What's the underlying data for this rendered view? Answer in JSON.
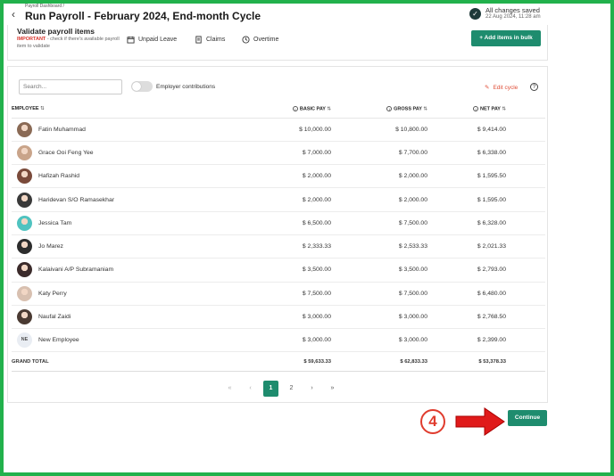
{
  "header": {
    "breadcrumb": "Payroll Dashboard /",
    "title": "Run Payroll - February 2024, End-month Cycle",
    "save_status": "All changes saved",
    "save_time": "22 Aug 2024, 11:28 am"
  },
  "validate": {
    "title": "Validate payroll items",
    "note_important": "IMPORTANT",
    "note_text": " - check if there's available payroll item to validate",
    "tabs": [
      {
        "label": "Unpaid Leave",
        "icon": "calendar-icon"
      },
      {
        "label": "Claims",
        "icon": "receipt-icon"
      },
      {
        "label": "Overtime",
        "icon": "clock-icon"
      }
    ],
    "bulk_button": "+ Add items in bulk"
  },
  "toolbar": {
    "search_placeholder": "Search...",
    "toggle_label": "Employer contributions",
    "toggle_on": false,
    "edit_cycle": "Edit cycle"
  },
  "table": {
    "columns": {
      "employee": "EMPLOYEE",
      "basic": "BASIC PAY",
      "gross": "GROSS PAY",
      "net": "NET PAY"
    },
    "rows": [
      {
        "name": "Fatin Muhammad",
        "basic": "$ 10,000.00",
        "gross": "$ 10,800.00",
        "net": "$ 9,414.00",
        "avatar_color": "#8a6a55"
      },
      {
        "name": "Grace Ooi Feng Yee",
        "basic": "$ 7,000.00",
        "gross": "$ 7,700.00",
        "net": "$ 6,338.00",
        "avatar_color": "#c9a48a"
      },
      {
        "name": "Hafizah Rashid",
        "basic": "$ 2,000.00",
        "gross": "$ 2,000.00",
        "net": "$ 1,595.50",
        "avatar_color": "#7a4a3a"
      },
      {
        "name": "Haridevan S/O Ramasekhar",
        "basic": "$ 2,000.00",
        "gross": "$ 2,000.00",
        "net": "$ 1,595.00",
        "avatar_color": "#3a3a3a"
      },
      {
        "name": "Jessica Tam",
        "basic": "$ 6,500.00",
        "gross": "$ 7,500.00",
        "net": "$ 6,328.00",
        "avatar_color": "#4fc3c0"
      },
      {
        "name": "Jo Marez",
        "basic": "$ 2,333.33",
        "gross": "$ 2,533.33",
        "net": "$ 2,021.33",
        "avatar_color": "#2d2d2d"
      },
      {
        "name": "Kalaivani A/P Subramaniam",
        "basic": "$ 3,500.00",
        "gross": "$ 3,500.00",
        "net": "$ 2,793.00",
        "avatar_color": "#3b2b2b"
      },
      {
        "name": "Katy Perry",
        "basic": "$ 7,500.00",
        "gross": "$ 7,500.00",
        "net": "$ 6,480.00",
        "avatar_color": "#d8c0b0"
      },
      {
        "name": "Naufal Zaidi",
        "basic": "$ 3,000.00",
        "gross": "$ 3,000.00",
        "net": "$ 2,768.50",
        "avatar_color": "#4a3a32"
      },
      {
        "name": "New Employee",
        "basic": "$ 3,000.00",
        "gross": "$ 3,000.00",
        "net": "$ 2,399.00",
        "initials": "NE"
      }
    ],
    "total": {
      "label": "GRAND TOTAL",
      "basic": "$ 59,633.33",
      "gross": "$ 62,833.33",
      "net": "$ 53,378.33"
    }
  },
  "pagination": {
    "first": "«",
    "prev": "‹",
    "pages": [
      "1",
      "2"
    ],
    "active": "1",
    "next": "›",
    "last": "»"
  },
  "annotation": {
    "step": "4"
  },
  "footer": {
    "continue_button": "Continue"
  },
  "colors": {
    "accent": "#1e8c6e",
    "frame": "#22b14c",
    "warning": "#e03c2e"
  }
}
